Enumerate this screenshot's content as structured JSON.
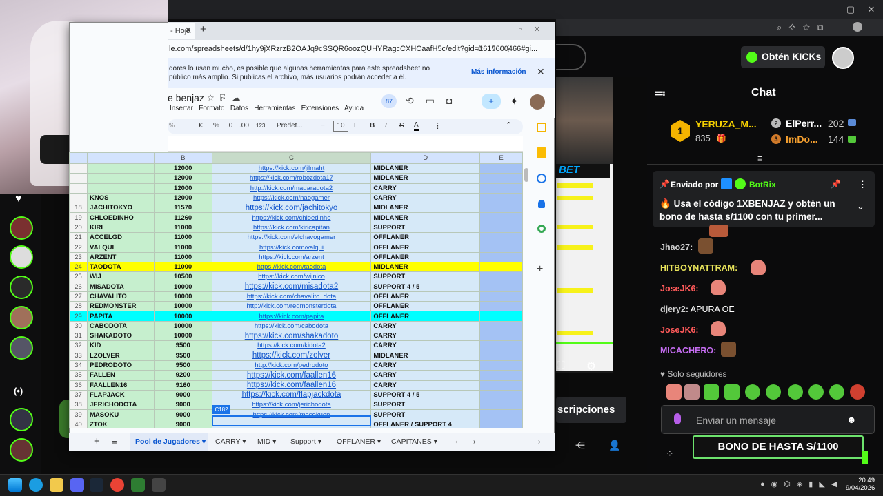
{
  "sheets": {
    "tab_title": "- Hoja",
    "url": "le.com/spreadsheets/d/1hy9jXRzrzB2OAJq9cSSQR6oozQUHYRagcCXHCaafH5c/edit?gid=1615600466#gi...",
    "banner_line1": "dores lo usan mucho, es posible que algunas herramientas para este spreadsheet no",
    "banner_line2": "público más amplio. Si publicas el archivo, más usuarios podrán acceder a él.",
    "banner_link": "Más información",
    "doc_title": "e benjaz",
    "menus": [
      "Insertar",
      "Formato",
      "Datos",
      "Herramientas",
      "Extensiones",
      "Ayuda"
    ],
    "badge_count": "87",
    "toolbar": {
      "zoom": "%",
      "currency": "€",
      "percent": "%",
      "dec_less": ".0",
      "dec_more": ".00",
      "format_123": "123",
      "font": "Predet...",
      "font_size": "10",
      "bold": "B",
      "italic": "I",
      "strike": "S",
      "text_color": "A"
    },
    "columns": [
      "B",
      "C",
      "D",
      "E"
    ],
    "rows": [
      {
        "n": "",
        "name": "",
        "score": "12000",
        "link": "https://kick.com/jilmaht",
        "role": "MIDLANER",
        "hl": ""
      },
      {
        "n": "",
        "name": "",
        "score": "12000",
        "link": "https://kick.com/robozdota17",
        "role": "MIDLANER",
        "hl": ""
      },
      {
        "n": "",
        "name": "",
        "score": "12000",
        "link": "http://kick.com/madaradota2",
        "role": "CARRY",
        "hl": ""
      },
      {
        "n": "",
        "name": "KNOS",
        "score": "12000",
        "link": "https://kick.com/naogamer",
        "role": "CARRY",
        "hl": ""
      },
      {
        "n": "18",
        "name": "JACHITOKYO",
        "score": "11570",
        "link": "https://kick.com/jachitokyo",
        "role": "MIDLANER",
        "hl": "",
        "big": true
      },
      {
        "n": "19",
        "name": "CHLOEDINHO",
        "score": "11260",
        "link": "https://kick.com/chloedinho",
        "role": "MIDLANER",
        "hl": ""
      },
      {
        "n": "20",
        "name": "KIRI",
        "score": "11000",
        "link": "https://kick.com/kiricapitan",
        "role": "SUPPORT",
        "hl": ""
      },
      {
        "n": "21",
        "name": "ACCELGD",
        "score": "11000",
        "link": "https://kick.com/elchavogamer",
        "role": "OFFLANER",
        "hl": ""
      },
      {
        "n": "22",
        "name": "VALQUI",
        "score": "11000",
        "link": "https://kick.com/valqui",
        "role": "OFFLANER",
        "hl": ""
      },
      {
        "n": "23",
        "name": "ARZENT",
        "score": "11000",
        "link": "https://kick.com/arzent",
        "role": "OFFLANER",
        "hl": ""
      },
      {
        "n": "24",
        "name": "TAODOTA",
        "score": "11000",
        "link": "https://kick.com/taodota",
        "role": "MIDLANER",
        "hl": "yel"
      },
      {
        "n": "25",
        "name": "WIJ",
        "score": "10500",
        "link": "https://kick.com/wijnico",
        "role": "SUPPORT",
        "hl": ""
      },
      {
        "n": "26",
        "name": "MISADOTA",
        "score": "10000",
        "link": "https://kick.com/misadota2",
        "role": "SUPPORT 4 / 5",
        "hl": "",
        "big": true
      },
      {
        "n": "27",
        "name": "CHAVALITO",
        "score": "10000",
        "link": "https://kick.com/chavalito_dota",
        "role": "OFFLANER",
        "hl": ""
      },
      {
        "n": "28",
        "name": "REDMONSTER",
        "score": "10000",
        "link": "http://kick.com/redmonsterdota",
        "role": "OFFLANER",
        "hl": ""
      },
      {
        "n": "29",
        "name": "PAPITA",
        "score": "10000",
        "link": "https://kick.com/papita",
        "role": "OFFLANER",
        "hl": "cya"
      },
      {
        "n": "30",
        "name": "CABODOTA",
        "score": "10000",
        "link": "https://kick.com/cabodota",
        "role": "CARRY",
        "hl": ""
      },
      {
        "n": "31",
        "name": "SHAKADOTO",
        "score": "10000",
        "link": "https://kick.com/shakadoto",
        "role": "CARRY",
        "hl": "",
        "big": true
      },
      {
        "n": "32",
        "name": "KID",
        "score": "9500",
        "link": "https://kick.com/kidota2",
        "role": "CARRY",
        "hl": ""
      },
      {
        "n": "33",
        "name": "LZOLVER",
        "score": "9500",
        "link": "https://kick.com/zolver",
        "role": "MIDLANER",
        "hl": "",
        "big": true
      },
      {
        "n": "34",
        "name": "PEDRODOTO",
        "score": "9500",
        "link": "http://kick.com/pedrodoto",
        "role": "CARRY",
        "hl": ""
      },
      {
        "n": "35",
        "name": "FALLEN",
        "score": "9200",
        "link": "https://kick.com/faallen16",
        "role": "CARRY",
        "hl": "",
        "big": true
      },
      {
        "n": "36",
        "name": "FAALLEN16",
        "score": "9160",
        "link": "https://kick.com/faallen16",
        "role": "CARRY",
        "hl": "",
        "big": true
      },
      {
        "n": "37",
        "name": "FLAPJACK",
        "score": "9000",
        "link": "https://kick.com/flapjackdota",
        "role": "SUPPORT 4 / 5",
        "hl": "",
        "big": true
      },
      {
        "n": "38",
        "name": "JERICHODOTA",
        "score": "9000",
        "link": "https://kick.com/jerichodota",
        "role": "SUPPORT",
        "hl": ""
      },
      {
        "n": "39",
        "name": "MASOKU",
        "score": "9000",
        "link": "https://kick.com/masokuen",
        "role": "SUPPORT",
        "hl": ""
      },
      {
        "n": "40",
        "name": "ZTOK",
        "score": "9000",
        "link": "",
        "role": "OFFLANER / SUPPORT 4",
        "hl": ""
      }
    ],
    "cell_ref": "C182",
    "sheet_tabs": [
      "Pool de Jugadores",
      "CARRY",
      "MID",
      "Support",
      "OFFLANER",
      "CAPITANES"
    ]
  },
  "kick": {
    "cta": "Obtén KICKs",
    "chat_title": "Chat",
    "leaders": [
      {
        "rank": "1",
        "name": "YERUZA_M...",
        "count": "835"
      },
      {
        "rank": "2",
        "name": "ElPerr...",
        "count": "202"
      },
      {
        "rank": "3",
        "name": "ImDo...",
        "count": "144"
      }
    ],
    "pinned": {
      "by": "Enviado por",
      "user": "BotRix",
      "text": "Usa el código 1XBENJAZ y obtén un bono de hasta s/1100 con tu primer..."
    },
    "messages": [
      {
        "user": "Jhao27:",
        "text": "",
        "color": "#d0d0d0"
      },
      {
        "user": "HITBOYNATTRAM:",
        "text": "",
        "color": "#e8e35a"
      },
      {
        "user": "JoseJK6:",
        "text": "",
        "color": "#ff5a5a"
      },
      {
        "user": "djery2:",
        "text": "APURA OE",
        "color": "#d0d0d0"
      },
      {
        "user": "JoseJK6:",
        "text": "",
        "color": "#ff5a5a"
      },
      {
        "user": "MICACHERO:",
        "text": "",
        "color": "#c46cf0"
      }
    ],
    "followers_only": "Solo seguidores",
    "send_placeholder": "Enviar un mensaje",
    "subscriptions_button": "scripciones",
    "bono": "BONO DE HASTA S/1100",
    "bet_label": "BET"
  },
  "taskbar": {
    "time": "20:49",
    "date": "9/04/2026"
  },
  "colors": {
    "kick_green": "#53fc18",
    "sheets_blue": "#1155cc",
    "highlight_yellow": "#ffff00",
    "highlight_cyan": "#00ffff"
  }
}
